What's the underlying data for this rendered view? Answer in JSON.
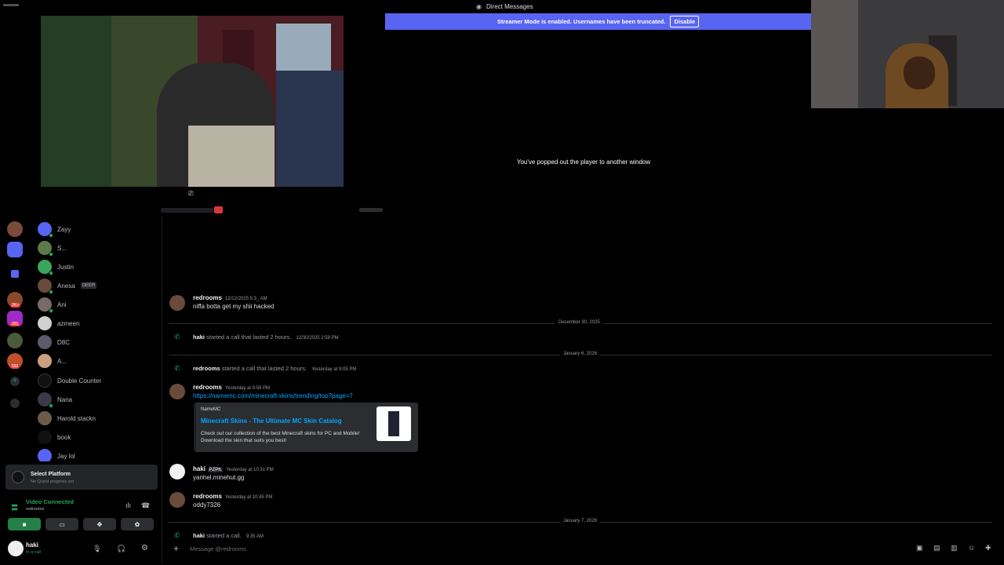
{
  "window": {
    "title": "Direct Messages"
  },
  "banner": {
    "text": "Streamer Mode is enabled. Usernames have been truncated.",
    "button": "Disable"
  },
  "player": {
    "popout_text": "You've popped out the player to another window"
  },
  "rail": {
    "badges": [
      "2K+",
      "361",
      "592"
    ]
  },
  "dms": [
    {
      "name": "Zayy"
    },
    {
      "name": "S..."
    },
    {
      "name": "Justin"
    },
    {
      "name": "Anesa",
      "tag": "DEER"
    },
    {
      "name": "Ani"
    },
    {
      "name": "azmeen"
    },
    {
      "name": "D8C"
    },
    {
      "name": "A..."
    },
    {
      "name": "Double Counter"
    },
    {
      "name": "Nana"
    },
    {
      "name": "Harold stackn"
    },
    {
      "name": "book"
    },
    {
      "name": "Jay lol"
    }
  ],
  "platform": {
    "title": "Select Platform",
    "subtitle": "No Quest progress yet"
  },
  "voice": {
    "status": "Video Connected",
    "channel": "redrooms"
  },
  "user": {
    "name": "haki",
    "status": "In a call"
  },
  "chat": {
    "messages": [
      {
        "author": "redrooms",
        "time": "12/12/2025 5:3_ AM",
        "text": "niffa botta get my shii hacked"
      },
      {
        "divider": "December 30, 2025"
      },
      {
        "system": true,
        "author": "haki",
        "text": "started a call that lasted 2 hours.",
        "time": "12/30/2025 2:59 PM"
      },
      {
        "divider": "January 6, 2026"
      },
      {
        "system": true,
        "author": "redrooms",
        "text": "started a call that lasted 2 hours.",
        "time": "Yesterday at 9:05 PM"
      },
      {
        "author": "redrooms",
        "time": "Yesterday at 9:59 PM",
        "link": "https://namemc.com/minecraft-skins/trending/top?page=7",
        "embed": {
          "provider": "NameMC",
          "title": "Minecraft Skins - The Ultimate MC Skin Catalog",
          "description": "Check out our collection of the best Minecraft skins for PC and Mobile! Download the skin that suits you best!"
        }
      },
      {
        "author": "haki",
        "badge": "PZPK",
        "time": "Yesterday at 10:31 PM",
        "text": "yanhel.minehut.gg"
      },
      {
        "author": "redrooms",
        "time": "Yesterday at 10:45 PM",
        "text": "oddy7326"
      },
      {
        "divider": "January 7, 2026"
      },
      {
        "system": true,
        "author": "haki",
        "text": "started a call.",
        "time": "9:35 AM"
      }
    ],
    "composer_placeholder": "Message @redrooms"
  }
}
